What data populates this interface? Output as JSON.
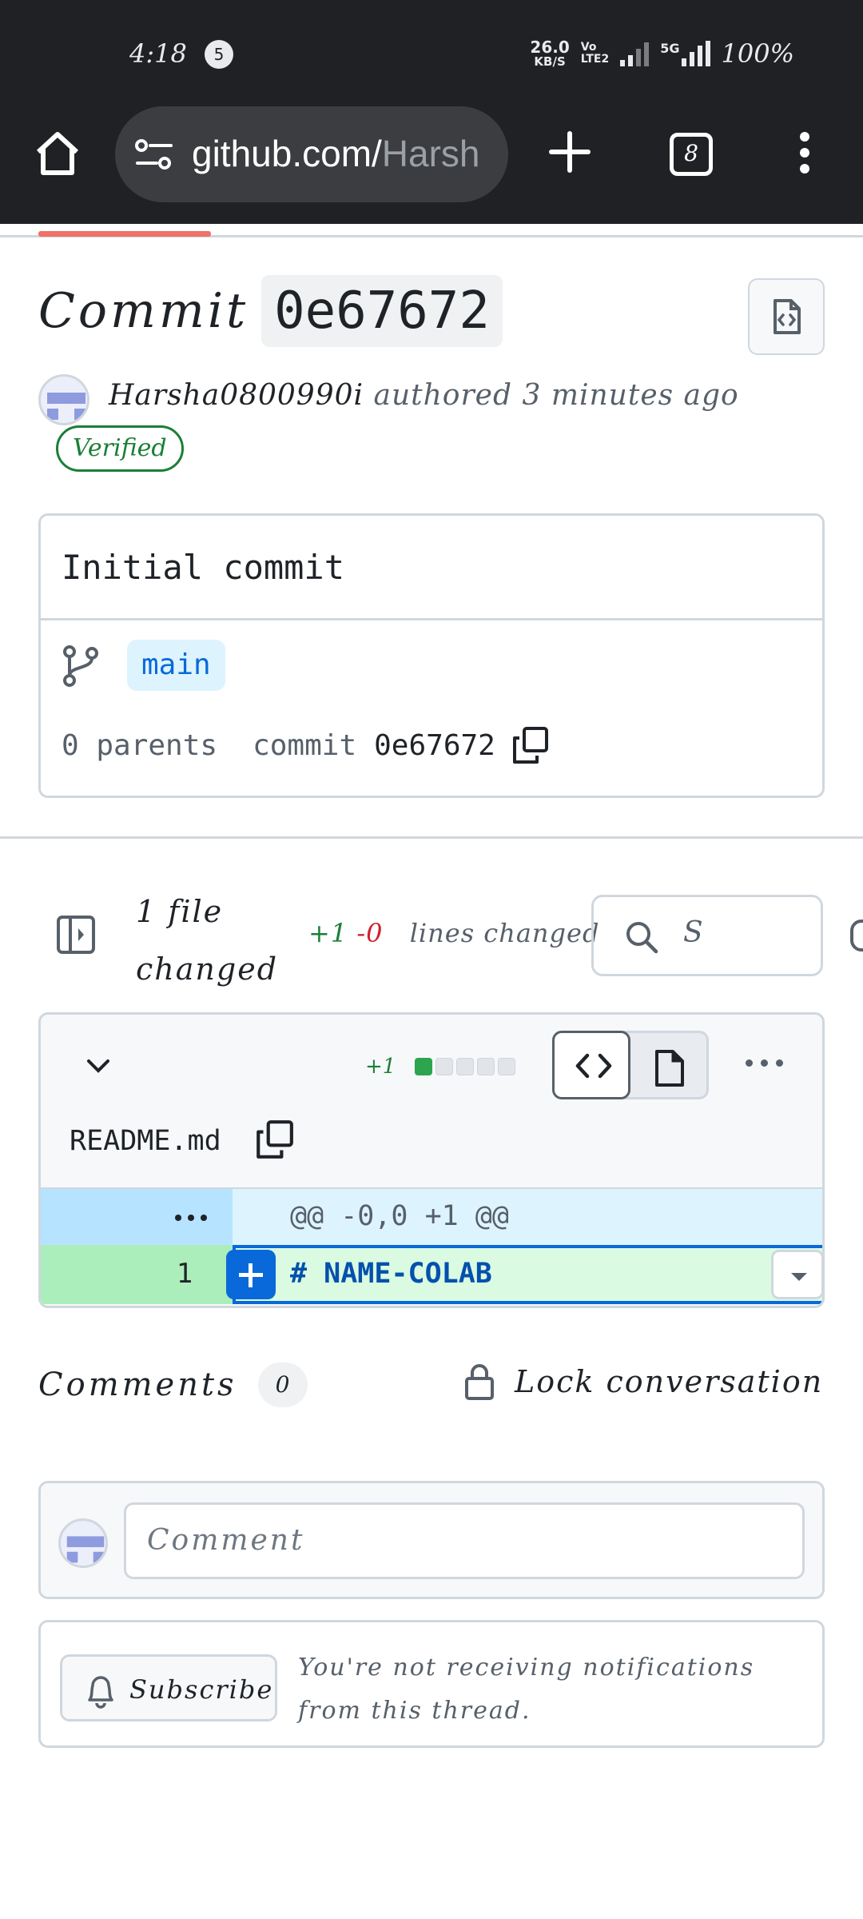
{
  "status_bar": {
    "time": "4:18",
    "notification_count": "5",
    "net_speed_value": "26.0",
    "net_speed_unit": "KB/S",
    "volte_top": "Vo",
    "volte_bottom": "LTE2",
    "network": "5G",
    "battery": "100%"
  },
  "browser": {
    "url_host": "github.com/",
    "url_path": "Harsh",
    "tab_count": "8",
    "icons": [
      "home-icon",
      "site-settings-icon",
      "new-tab-icon",
      "tabs-icon",
      "menu-icon"
    ],
    "progress": 0.13
  },
  "commit": {
    "title_word": "Commit",
    "sha_short": "0e67672",
    "author": "Harsha0800990i",
    "authored_text": "authored 3 minutes ago",
    "verified_label": "Verified",
    "message": "Initial commit",
    "branch": "main",
    "parents_text": "0 parents",
    "commit_label": "commit",
    "commit_sha": "0e67672"
  },
  "diff": {
    "files_changed": "1 file changed",
    "additions": "+1",
    "deletions": "-0",
    "lines_changed_label": "lines changed",
    "filter_value": "S",
    "file": {
      "name": "README.md",
      "stat_additions": "+1",
      "stat_blocks": [
        1,
        0,
        0,
        0,
        0
      ],
      "hunk_header": "@@ -0,0 +1 @@",
      "line_number": "1",
      "line_code": "# NAME-COLAB"
    }
  },
  "comments": {
    "label": "Comments",
    "count": "0",
    "lock_label": "Lock conversation",
    "comment_placeholder": "Comment",
    "subscribe_label": "Subscribe",
    "subscribe_note": "You're not receiving notifications from this thread."
  },
  "colors": {
    "chrome_bg": "#202124",
    "accent_blue": "#0969da",
    "success_green": "#1a7f37",
    "danger_red": "#cf222e",
    "progress": "#f07167"
  }
}
